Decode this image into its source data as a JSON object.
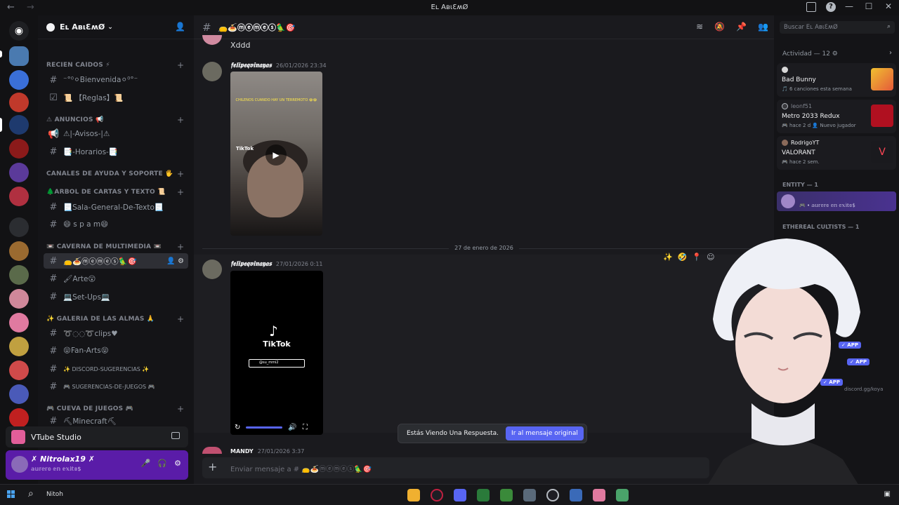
{
  "window": {
    "title": "Eʟ AвιƐʍØ",
    "back": "←",
    "forward": "→",
    "controls": [
      "—",
      "☐",
      "✕"
    ]
  },
  "guild": {
    "name": "Eʟ AвιƐʍØ"
  },
  "categories": [
    {
      "label": "RECIEN CAIDOS ⚡",
      "channels": [
        {
          "label": "⁻°⁰⚪Bienvenida⚪⁰°⁻",
          "icon": "#"
        },
        {
          "label": "📜 【Reglas】📜",
          "icon": "☑"
        }
      ]
    },
    {
      "label": "⚠ ANUNCIOS 📢",
      "channels": [
        {
          "label": "⚠|-Avisos-|⚠",
          "icon": "📢"
        },
        {
          "label": "📑-Horarios-📑",
          "icon": "#"
        }
      ]
    },
    {
      "label": "CANALES DE AYUDA Y SOPORTE 🖐",
      "channels": []
    },
    {
      "label": "🌲ARBOL DE CARTAS Y TEXTO 📜",
      "channels": [
        {
          "label": "📃Sala-General-De-Texto📃",
          "icon": "#"
        },
        {
          "label": "😄 s p a m😄",
          "icon": "#"
        }
      ]
    },
    {
      "label": "📼 CAVERNA DE MULTIMEDIA 📼",
      "channels": [
        {
          "label": "👝🍝ⓜⓔⓜⓔⓢ🦜🎯",
          "icon": "#",
          "active": true
        },
        {
          "label": "🖌Arte😮",
          "icon": "#"
        },
        {
          "label": "💻Set-Ups💻",
          "icon": "#"
        }
      ]
    },
    {
      "label": "✨ GALERIA DE LAS ALMAS 🙏",
      "channels": [
        {
          "label": "➰◌◌➰clips♥",
          "icon": "#"
        },
        {
          "label": "😝Fan-Arts😝",
          "icon": "#"
        },
        {
          "label": "✨ DISCORD-SUGERENCIAS ✨",
          "icon": "#"
        },
        {
          "label": "🎮 SUGERENCIAS-DE-JUEGOS 🎮",
          "icon": "#"
        }
      ]
    },
    {
      "label": "🎮 CUEVA DE JUEGOS 🎮",
      "channels": [
        {
          "label": "⛏Minecraft⛏",
          "icon": "#"
        }
      ]
    }
  ],
  "app_bar": {
    "label": "VTube Studio"
  },
  "user": {
    "name": "✗ Nitrolax19 ✗",
    "status": "𝕒𝕦𝕣𝕖𝕣𝕠 𝕖𝕟 𝕖𝕩𝕚𝕥𝕠$"
  },
  "channel_header": {
    "name": "👝🍝ⓜⓔⓜⓔⓢ🦜🎯"
  },
  "messages": [
    {
      "text": "Xddd"
    },
    {
      "user": "𝖋𝖊𝖑𝖎𝖕𝖊𝖖𝖛𝖎𝖓𝖆𝖞𝖆𝖘",
      "time": "26/01/2026 23:34",
      "caption": "CHILENOS CUANDO HAY UN TERREMOTO 😂😂",
      "tiktok": "TikTok"
    },
    {
      "user": "𝖋𝖊𝖑𝖎𝖕𝖊𝖖𝖛𝖎𝖓𝖆𝖞𝖆𝖘",
      "time": "27/01/2026 0:11",
      "video_title": "TikTok",
      "search_text": "@su_mmi2"
    }
  ],
  "date_divider": "27 de enero de 2026",
  "reply_bar": {
    "text": "Estás Viendo Una Respuesta.",
    "button": "Ir al mensaje original"
  },
  "last_message": {
    "user": "MANDY",
    "time": "27/01/2026 3:37"
  },
  "composer": {
    "placeholder": "Enviar mensaje a # 👝🍝ⓜⓔⓜⓔⓢ🦜🎯"
  },
  "search": {
    "placeholder": "Buscar Eʟ AвιƐʍØ"
  },
  "activity": {
    "header": "Actividad — 12",
    "items": [
      {
        "user": "",
        "title": "Bad Bunny",
        "sub": "🎵 6 canciones esta semana",
        "color": "#e55a3a"
      },
      {
        "user": "leonf51",
        "title": "Metro 2033 Redux",
        "sub": "🎮 hace 2 d   👤 Nuevo jugador",
        "color": "#b01020"
      },
      {
        "user": "RodrigoYT",
        "title": "VALORANT",
        "sub": "🎮 hace 2 sem.",
        "color": "#1a1a1e"
      }
    ]
  },
  "member_groups": [
    {
      "label": "ENTITY — 1",
      "member_status": "🎮 • 𝕒𝕦𝕣𝕖𝕣𝕠 𝕖𝕟 𝕖𝕩𝕚𝕥𝕠$"
    },
    {
      "label": "ETHEREAL CULTISTS — 1"
    }
  ],
  "app_badges": [
    "✓ APP",
    "✓ APP",
    "✓ APP"
  ],
  "invite_text": "discord.gg/koya",
  "taskbar": {
    "search_text": "Nitoh"
  }
}
